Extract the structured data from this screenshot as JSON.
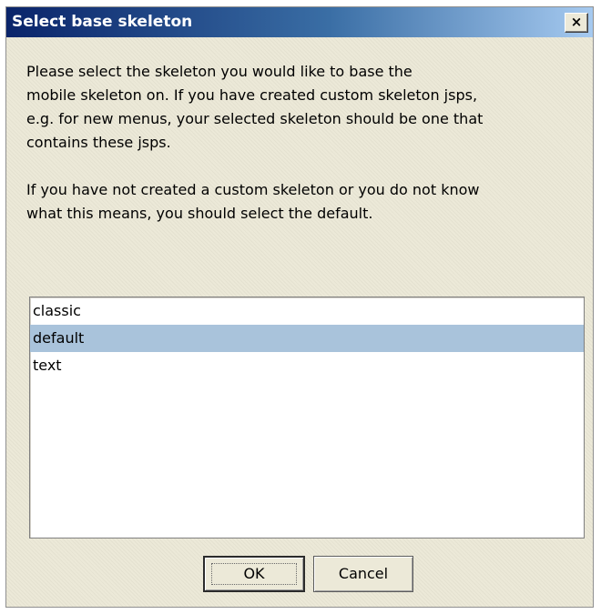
{
  "dialog": {
    "title": "Select base skeleton",
    "close_label": "×",
    "message_lines_1": [
      "Please select the skeleton you would like to base the",
      "mobile skeleton on. If you have created custom skeleton jsps,",
      "e.g. for new menus, your selected skeleton should be one that",
      "contains these jsps."
    ],
    "message_lines_2": [
      "If you have not created a custom skeleton or you do not know",
      "what this means, you should select the default."
    ]
  },
  "skeleton_list": {
    "items": [
      "classic",
      "default",
      "text"
    ],
    "selected": "default"
  },
  "buttons": {
    "ok_label": "OK",
    "cancel_label": "Cancel"
  },
  "colors": {
    "title_gradient_start": "#0a246a",
    "title_gradient_end": "#a6caf0",
    "selection": "#a9c3db",
    "dialog_background": "#ece9d8"
  }
}
